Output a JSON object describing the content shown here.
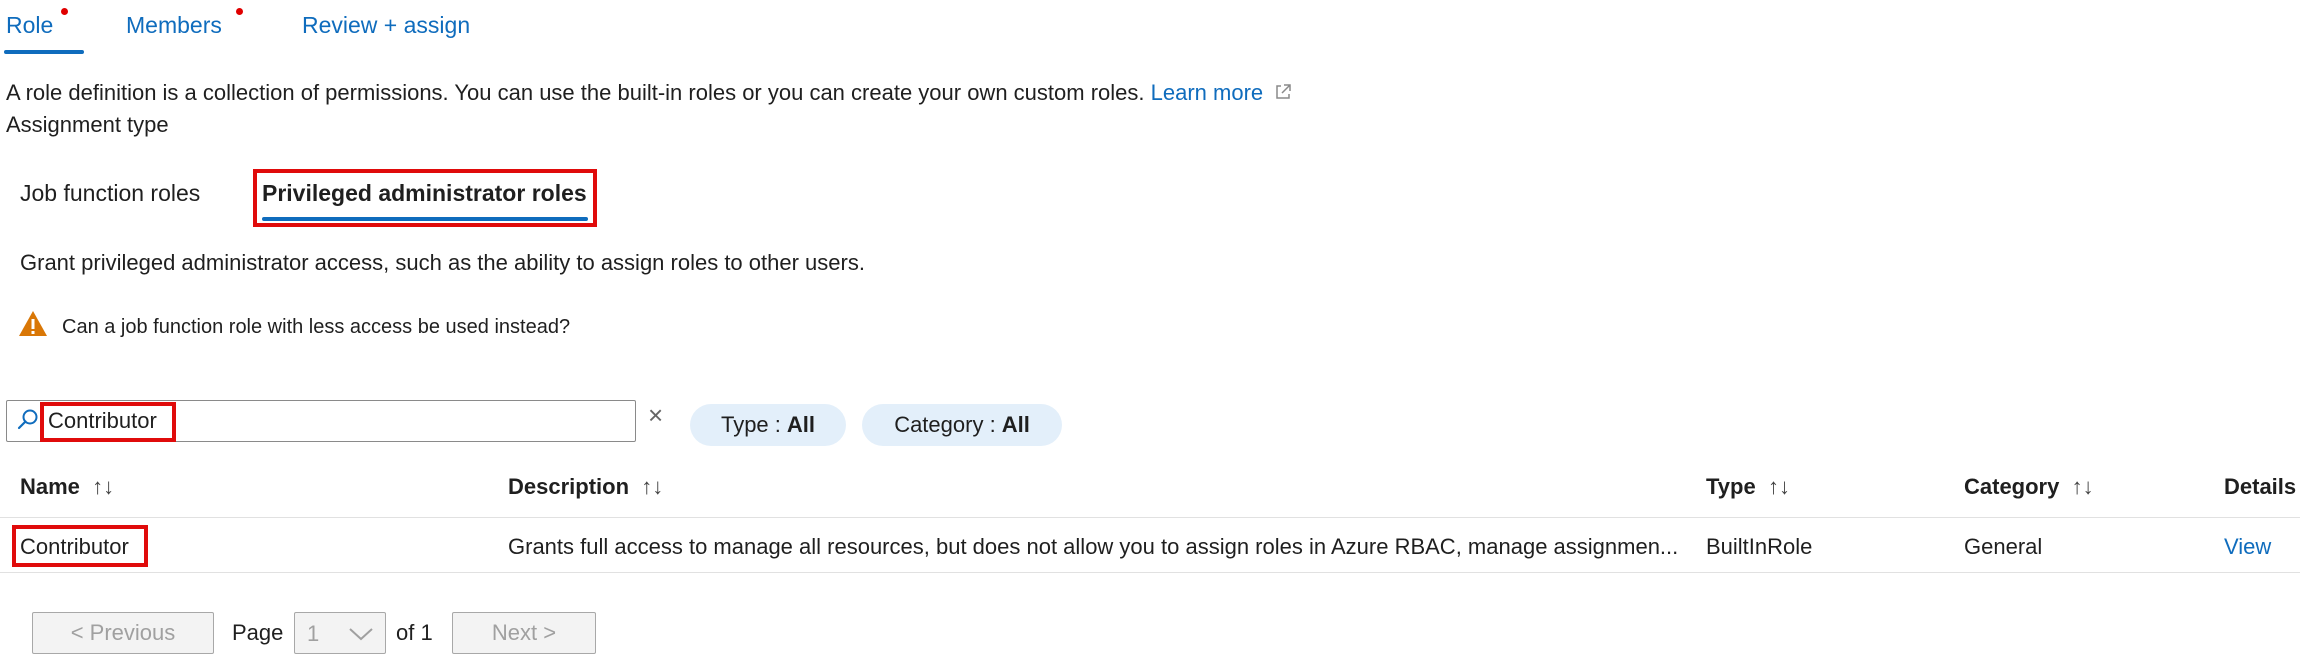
{
  "tabs": [
    {
      "label": "Role",
      "required": true
    },
    {
      "label": "Members",
      "required": true
    },
    {
      "label": "Review + assign",
      "required": false
    }
  ],
  "intro": {
    "text": "A role definition is a collection of permissions. You can use the built-in roles or you can create your own custom roles.",
    "learn_more": "Learn more"
  },
  "assignment_type_label": "Assignment type",
  "role_tabs": {
    "job_function": "Job function roles",
    "privileged_admin": "Privileged administrator roles"
  },
  "privileged_description": "Grant privileged administrator access, such as the ability to assign roles to other users.",
  "warning_text": "Can a job function role with less access be used instead?",
  "search": {
    "value": "Contributor",
    "clear_icon": "×"
  },
  "filters": {
    "type": {
      "label": "Type :",
      "value": "All"
    },
    "category": {
      "label": "Category :",
      "value": "All"
    }
  },
  "table": {
    "columns": [
      "Name",
      "Description",
      "Type",
      "Category",
      "Details"
    ],
    "rows": [
      {
        "name": "Contributor",
        "description": "Grants full access to manage all resources, but does not allow you to assign roles in Azure RBAC, manage assignmen...",
        "type": "BuiltInRole",
        "category": "General",
        "details": "View"
      }
    ]
  },
  "pagination": {
    "previous": "< Previous",
    "page_label": "Page",
    "page_value": "1",
    "of_label": "of 1",
    "next": "Next >"
  },
  "colors": {
    "accent": "#0f6cbd",
    "highlight": "#e00b0b",
    "warning": "#d97706"
  }
}
